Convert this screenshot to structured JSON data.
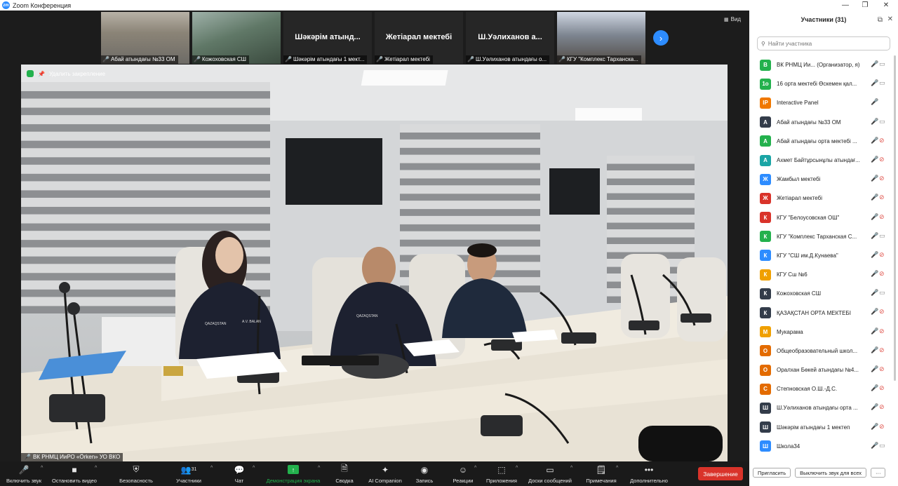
{
  "window": {
    "title": "Zoom Конференция",
    "logo_text": "zm",
    "controls": {
      "minimize": "—",
      "maximize": "❐",
      "close": "✕"
    }
  },
  "thumbnails": [
    {
      "type": "video",
      "caption": "Абай атындағы №33 ОМ"
    },
    {
      "type": "video",
      "caption": "Кожоховская СШ"
    },
    {
      "type": "name",
      "big_name": "Шәкәрім атынд...",
      "caption": "Шәкәрім атындағы 1 мект..."
    },
    {
      "type": "name",
      "big_name": "Жетіарал мектебі",
      "caption": "Жетіарал мектебі"
    },
    {
      "type": "name",
      "big_name": "Ш.Уәлиханов а...",
      "caption": "Ш.Уәлиханов атындағы о..."
    },
    {
      "type": "video",
      "caption": "КГУ \"Комплекс Тарханска..."
    }
  ],
  "view_button": "Вид",
  "main_video": {
    "pin_label": "Удалить закрепление",
    "speaker_caption": "ВК РНМЦ ИиРО «Örken» УО ВКО",
    "badges": [
      "QAZAQSTAN",
      "A.V. BALAN",
      "QAZAQSTAN"
    ]
  },
  "toolbar": {
    "mute": "Включить звук",
    "video": "Остановить видео",
    "video_count": "",
    "security": "Безопасность",
    "participants": "Участники",
    "participants_count": "31",
    "chat": "Чат",
    "share": "Демонстрация экрана",
    "summary": "Сводка",
    "ai": "AI Companion",
    "record": "Запись",
    "reactions": "Реакции",
    "apps": "Приложения",
    "whiteboards": "Доски сообщений",
    "notes": "Примечания",
    "more": "Дополнительно",
    "end": "Завершение"
  },
  "colors": {
    "accent": "#2d8cff",
    "end": "#d9332a",
    "share": "#23b14d",
    "muted": "#e0524b"
  },
  "participants_panel": {
    "title": "Участники (31)",
    "search_placeholder": "Найти участника",
    "invite": "Пригласить",
    "mute_all": "Выключить звук для всех",
    "more": "···",
    "items": [
      {
        "initial": "В",
        "color": "#23b14d",
        "name": "ВК РНМЦ Ии... (Организатор, я)",
        "cam_off": false
      },
      {
        "initial": "1о",
        "color": "#23b14d",
        "name": "16 орта мектебі Өскемен қал...",
        "cam_off": false
      },
      {
        "initial": "IP",
        "color": "#f07800",
        "name": "Interactive Panel",
        "cam_off": null
      },
      {
        "initial": "А",
        "color": "#333c4a",
        "name": "Абай атындағы №33 ОМ",
        "cam_off": false
      },
      {
        "initial": "А",
        "color": "#23b14d",
        "name": "Абай атындағы орта мектебі ...",
        "cam_off": true
      },
      {
        "initial": "А",
        "color": "#1aa5a5",
        "name": "Ахмет Байтұрсынұлы атындағ...",
        "cam_off": true
      },
      {
        "initial": "Ж",
        "color": "#2d8cff",
        "name": "Жамбыл мектебі",
        "cam_off": true
      },
      {
        "initial": "Ж",
        "color": "#d9332a",
        "name": "Жетіарал мектебі",
        "cam_off": true
      },
      {
        "initial": "К",
        "color": "#d9332a",
        "name": "КГУ \"Белоусовская ОШ\"",
        "cam_off": true
      },
      {
        "initial": "К",
        "color": "#23b14d",
        "name": "КГУ \"Комплекс Тарханская С...",
        "cam_off": false
      },
      {
        "initial": "К",
        "color": "#2d8cff",
        "name": "КГУ \"СШ им.Д.Кунаева\"",
        "cam_off": true
      },
      {
        "initial": "К",
        "color": "#f0a000",
        "name": "КГУ Сш №6",
        "cam_off": true
      },
      {
        "initial": "К",
        "color": "#333c4a",
        "name": "Кожоховская СШ",
        "cam_off": false
      },
      {
        "initial": "К",
        "color": "#333c4a",
        "name": "ҚАЗАҚСТАН ОРТА МЕКТЕБІ",
        "cam_off": true
      },
      {
        "initial": "М",
        "color": "#f0a000",
        "name": "Мукарама",
        "cam_off": true
      },
      {
        "initial": "О",
        "color": "#e36b00",
        "name": "Общеобразовательный школ...",
        "cam_off": true
      },
      {
        "initial": "О",
        "color": "#e36b00",
        "name": "Оралхан Бөкей атындағы №4...",
        "cam_off": true
      },
      {
        "initial": "С",
        "color": "#e36b00",
        "name": "Степновская О.Ш.-Д.С.",
        "cam_off": true
      },
      {
        "initial": "Ш",
        "color": "#333c4a",
        "name": "Ш.Уәлиханов атындағы орта ...",
        "cam_off": true
      },
      {
        "initial": "Ш",
        "color": "#333c4a",
        "name": "Шәкәрім атындағы 1 мектеп",
        "cam_off": true
      },
      {
        "initial": "Ш",
        "color": "#2d8cff",
        "name": "Школа34",
        "cam_off": false
      }
    ]
  }
}
